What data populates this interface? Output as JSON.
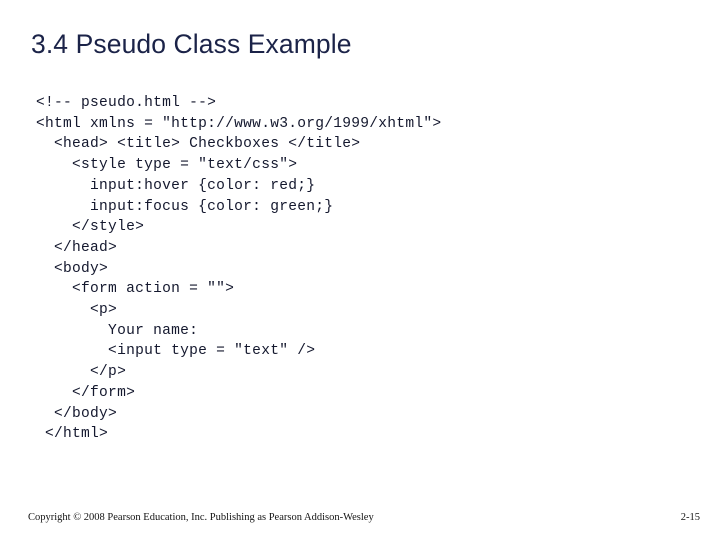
{
  "slide": {
    "title": "3.4 Pseudo Class Example",
    "title_color": "#1b2348",
    "background_color": "#ffffff",
    "code_color": "#14182e"
  },
  "code": {
    "lines": [
      "<!-- pseudo.html -->",
      "<html xmlns = \"http://www.w3.org/1999/xhtml\">",
      "  <head> <title> Checkboxes </title>",
      "    <style type = \"text/css\">",
      "      input:hover {color: red;}",
      "      input:focus {color: green;}",
      "    </style>",
      "  </head>",
      "  <body>",
      "    <form action = \"\">",
      "      <p>",
      "        Your name:",
      "        <input type = \"text\" />",
      "      </p>",
      "    </form>",
      "  </body>",
      " </html>"
    ]
  },
  "footer": {
    "copyright": "Copyright © 2008 Pearson Education, Inc. Publishing as Pearson Addison-Wesley",
    "page_number": "2-15"
  }
}
